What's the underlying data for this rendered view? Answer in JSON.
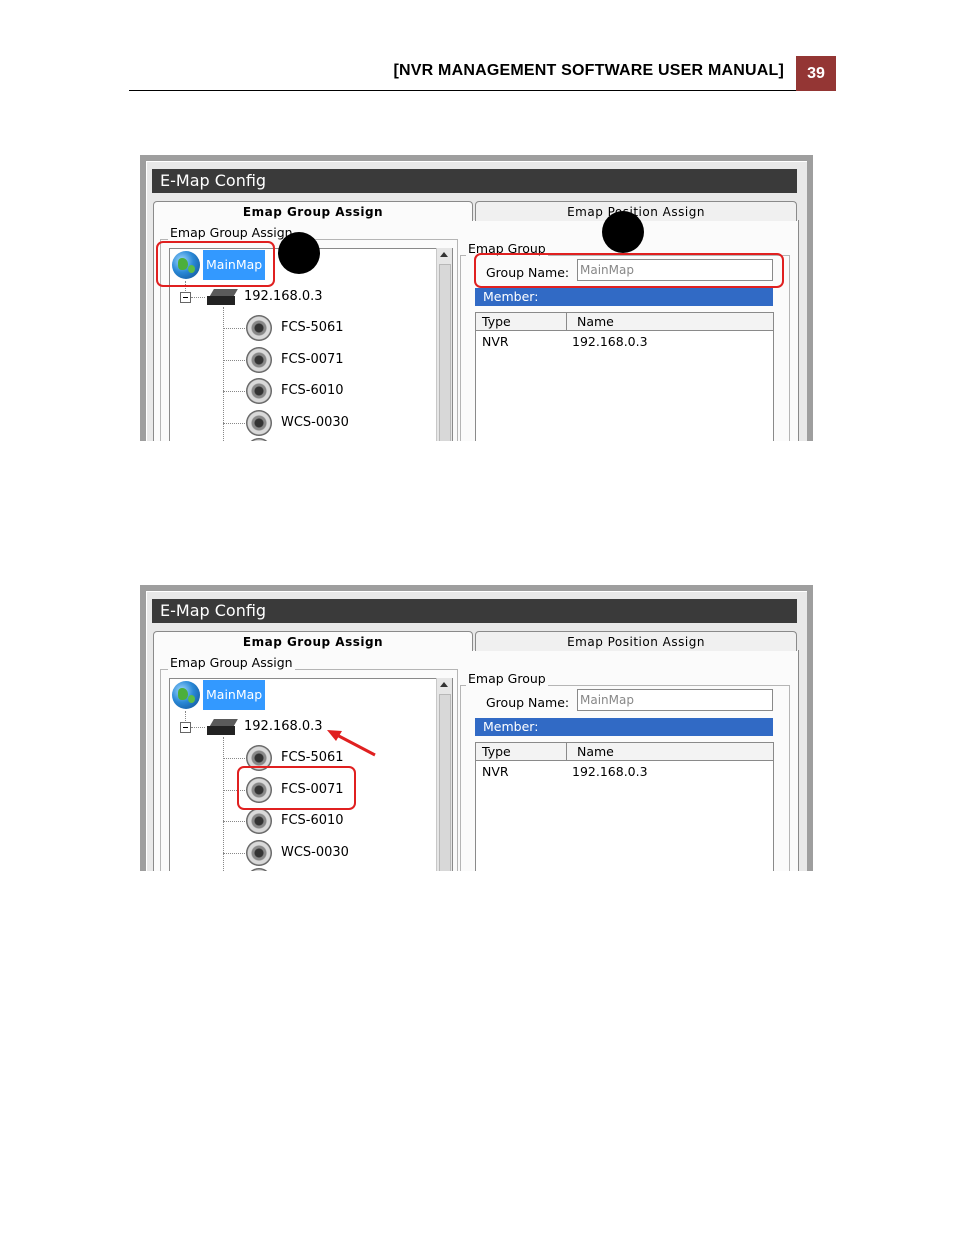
{
  "header": {
    "title": "[NVR MANAGEMENT SOFTWARE USER MANUAL]",
    "page_number": "39",
    "accent_color": "#943634"
  },
  "screenshots": [
    {
      "window_title": "E-Map Config",
      "tabs": [
        "Emap Group Assign",
        "Emap Position Assign"
      ],
      "active_tab": 0,
      "tree_group_label": "Emap Group Assign",
      "tree": {
        "root": "MainMap",
        "nvr": "192.168.0.3",
        "cameras": [
          "FCS-5061",
          "FCS-0071",
          "FCS-6010",
          "WCS-0030"
        ]
      },
      "emap_group_label": "Emap Group",
      "group_name_label": "Group Name:",
      "group_name_value": "MainMap",
      "member_label": "Member:",
      "columns": [
        "Type",
        "Name"
      ],
      "rows": [
        [
          "NVR",
          "192.168.0.3"
        ]
      ]
    },
    {
      "window_title": "E-Map Config",
      "tabs": [
        "Emap Group Assign",
        "Emap Position Assign"
      ],
      "active_tab": 0,
      "tree_group_label": "Emap Group Assign",
      "tree": {
        "root": "MainMap",
        "nvr": "192.168.0.3",
        "cameras": [
          "FCS-5061",
          "FCS-0071",
          "FCS-6010",
          "WCS-0030"
        ]
      },
      "emap_group_label": "Emap Group",
      "group_name_label": "Group Name:",
      "group_name_value": "MainMap",
      "member_label": "Member:",
      "columns": [
        "Type",
        "Name"
      ],
      "rows": [
        [
          "NVR",
          "192.168.0.3"
        ]
      ]
    }
  ]
}
